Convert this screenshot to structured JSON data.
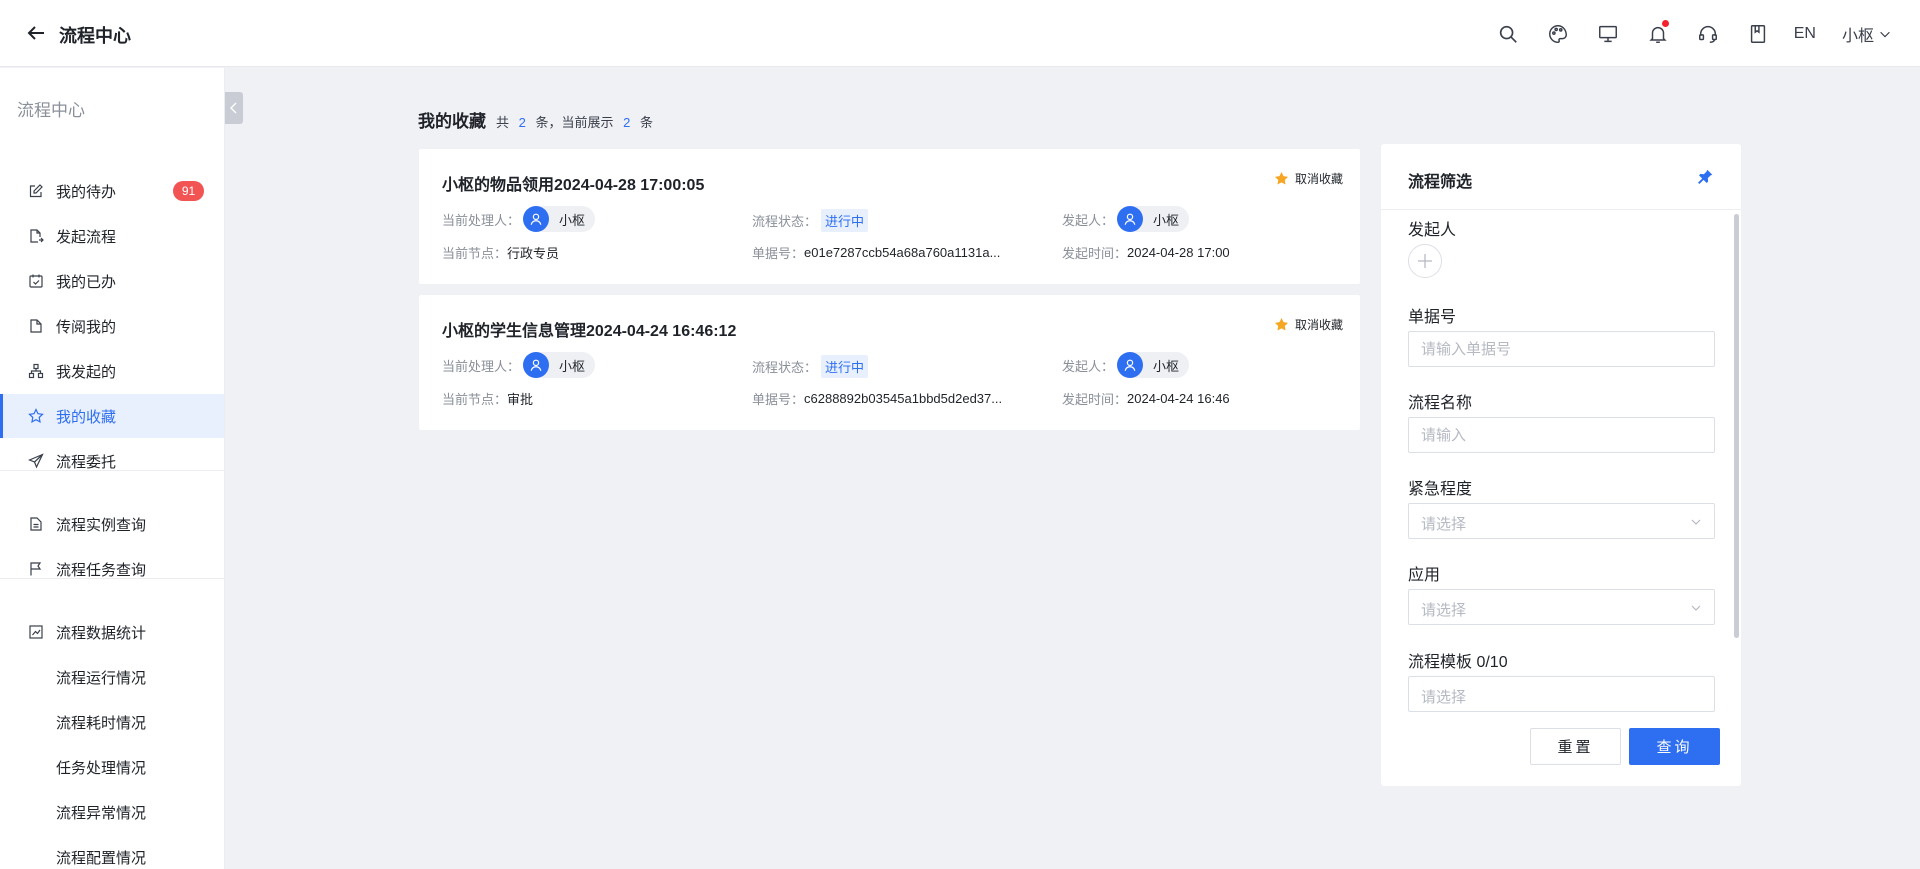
{
  "header": {
    "title": "流程中心",
    "lang": "EN",
    "user": "小枢",
    "icons": [
      "search-icon",
      "palette-icon",
      "monitor-icon",
      "bell-icon",
      "headset-icon",
      "book-icon"
    ]
  },
  "sidebar": {
    "title": "流程中心",
    "items": [
      {
        "label": "我的待办",
        "icon": "edit-icon",
        "badge": "91"
      },
      {
        "label": "发起流程",
        "icon": "file-export-icon"
      },
      {
        "label": "我的已办",
        "icon": "calendar-check-icon"
      },
      {
        "label": "传阅我的",
        "icon": "document-icon"
      },
      {
        "label": "我发起的",
        "icon": "hierarchy-icon"
      },
      {
        "label": "我的收藏",
        "icon": "star-icon",
        "active": true
      },
      {
        "label": "流程委托",
        "icon": "send-icon"
      },
      {
        "label": "流程实例查询",
        "icon": "report-icon"
      },
      {
        "label": "流程任务查询",
        "icon": "flag-icon"
      },
      {
        "label": "流程数据统计",
        "icon": "chart-icon"
      },
      {
        "label": "流程运行情况"
      },
      {
        "label": "流程耗时情况"
      },
      {
        "label": "任务处理情况"
      },
      {
        "label": "流程异常情况"
      },
      {
        "label": "流程配置情况"
      }
    ]
  },
  "list": {
    "title": "我的收藏",
    "total_prefix": "共",
    "total": "2",
    "total_suffix": "条，当前展示",
    "shown": "2",
    "shown_suffix": "条"
  },
  "labels": {
    "handler": "当前处理人：",
    "status": "流程状态：",
    "initiator": "发起人：",
    "node": "当前节点：",
    "doc_no": "单据号：",
    "start_time": "发起时间：",
    "unfavorite": "取消收藏"
  },
  "cards": [
    {
      "title": "小枢的物品领用2024-04-28 17:00:05",
      "handler": "小枢",
      "status": "进行中",
      "initiator": "小枢",
      "node": "行政专员",
      "doc_no": "e01e7287ccb54a68a760a1131a...",
      "start_time": "2024-04-28 17:00"
    },
    {
      "title": "小枢的学生信息管理2024-04-24 16:46:12",
      "handler": "小枢",
      "status": "进行中",
      "initiator": "小枢",
      "node": "审批",
      "doc_no": "c6288892b03545a1bbd5d2ed37...",
      "start_time": "2024-04-24 16:46"
    }
  ],
  "filter": {
    "title": "流程筛选",
    "initiator_label": "发起人",
    "doc_no_label": "单据号",
    "doc_no_placeholder": "请输入单据号",
    "name_label": "流程名称",
    "name_placeholder": "请输入",
    "urgency_label": "紧急程度",
    "urgency_placeholder": "请选择",
    "app_label": "应用",
    "app_placeholder": "请选择",
    "template_label": "流程模板 0/10",
    "template_placeholder": "请选择",
    "reset_label": "重置",
    "query_label": "查询"
  },
  "colors": {
    "accent": "#2e6ff2",
    "badge": "#f25353",
    "star": "#f5a623",
    "notification_dot": "#f5222d"
  }
}
